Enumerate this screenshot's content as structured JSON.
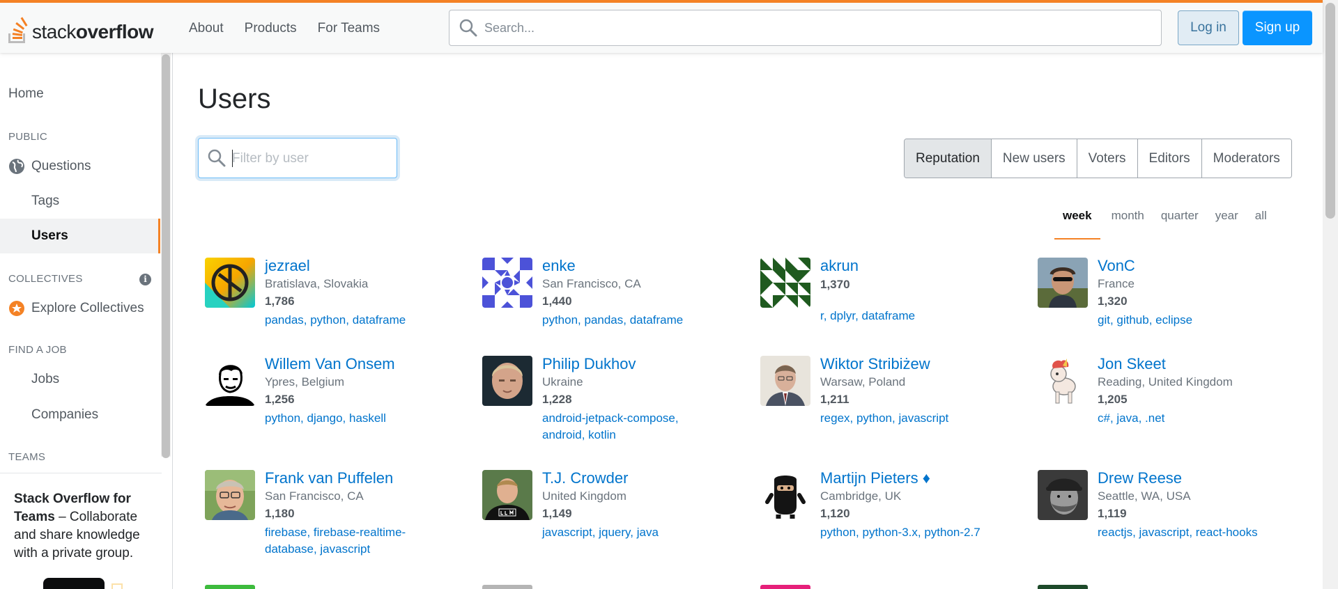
{
  "header": {
    "logo_light": "stack",
    "logo_bold": "overflow",
    "nav": [
      "About",
      "Products",
      "For Teams"
    ],
    "search_placeholder": "Search...",
    "login_label": "Log in",
    "signup_label": "Sign up",
    "accent_color": "#f48225"
  },
  "sidebar": {
    "home": "Home",
    "public_heading": "PUBLIC",
    "questions": "Questions",
    "tags": "Tags",
    "users": "Users",
    "collectives_heading": "COLLECTIVES",
    "info_glyph": "i",
    "explore_collectives": "Explore Collectives",
    "job_heading": "FIND A JOB",
    "jobs": "Jobs",
    "companies": "Companies",
    "teams_heading": "TEAMS",
    "teams_title": "Stack Overflow for Teams",
    "teams_desc": " – Collaborate and share knowledge with a private group."
  },
  "main": {
    "title": "Users",
    "filter_placeholder": "Filter by user",
    "tabs": [
      "Reputation",
      "New users",
      "Voters",
      "Editors",
      "Moderators"
    ],
    "periods": [
      "week",
      "month",
      "quarter",
      "year",
      "all"
    ]
  },
  "users": [
    {
      "name": "jezrael",
      "location": "Bratislava, Slovakia",
      "rep": "1,786",
      "tags": "pandas, python, dataframe",
      "avatar": "yellow-green-ring"
    },
    {
      "name": "enke",
      "location": "San Francisco, CA",
      "rep": "1,440",
      "tags": "python, pandas, dataframe",
      "avatar": "blue-identicon"
    },
    {
      "name": "akrun",
      "location": "",
      "rep": "1,370",
      "tags": "r, dplyr, dataframe",
      "avatar": "green-identicon"
    },
    {
      "name": "VonC",
      "location": "France",
      "rep": "1,320",
      "tags": "git, github, eclipse",
      "avatar": "photo"
    },
    {
      "name": "Willem Van Onsem",
      "location": "Ypres, Belgium",
      "rep": "1,256",
      "tags": "python, django, haskell",
      "avatar": "bw-portrait"
    },
    {
      "name": "Philip Dukhov",
      "location": "Ukraine",
      "rep": "1,228",
      "tags": "android-jetpack-compose,\nandroid, kotlin",
      "avatar": "photo"
    },
    {
      "name": "Wiktor Stribiżew",
      "location": "Warsaw, Poland",
      "rep": "1,211",
      "tags": "regex, python, javascript",
      "avatar": "photo"
    },
    {
      "name": "Jon Skeet",
      "location": "Reading, United Kingdom",
      "rep": "1,205",
      "tags": "c#, java, .net",
      "avatar": "unicorn"
    },
    {
      "name": "Frank van Puffelen",
      "location": "San Francisco, CA",
      "rep": "1,180",
      "tags": "firebase, firebase-realtime-\ndatabase, javascript",
      "avatar": "photo"
    },
    {
      "name": "T.J. Crowder",
      "location": "United Kingdom",
      "rep": "1,149",
      "tags": "javascript, jquery, java",
      "avatar": "photo"
    },
    {
      "name": "Martijn Pieters ♦",
      "location": "Cambridge, UK",
      "rep": "1,120",
      "tags": "python, python-3.x, python-2.7",
      "avatar": "ninja"
    },
    {
      "name": "Drew Reese",
      "location": "Seattle, WA, USA",
      "rep": "1,119",
      "tags": "reactjs, javascript, react-hooks",
      "avatar": "bw-photo"
    }
  ]
}
